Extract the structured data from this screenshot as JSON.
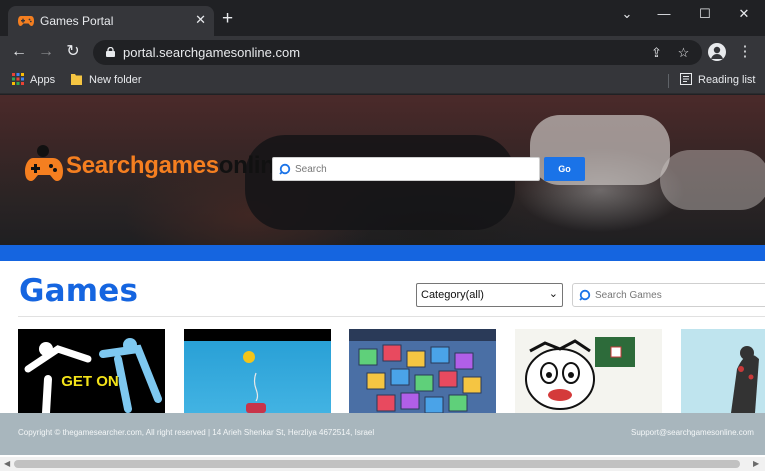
{
  "browser": {
    "tab_title": "Games Portal",
    "url": "portal.searchgamesonline.com",
    "bookmarks": {
      "apps_label": "Apps",
      "folder_label": "New folder",
      "reading_list_label": "Reading list"
    }
  },
  "page": {
    "logo": {
      "part1": "Searchgames",
      "part2": "online"
    },
    "hero_search": {
      "placeholder": "Search",
      "button": "Go"
    },
    "section_title": "Games",
    "category_select": {
      "selected": "Category(all)"
    },
    "games_search": {
      "placeholder": "Search Games"
    },
    "thumbnails": [
      {
        "text": "GET ON"
      },
      {
        "text": ""
      },
      {
        "text": ""
      },
      {
        "text": ""
      },
      {
        "text": ""
      }
    ],
    "footer": {
      "copyright": "Copyright © thegamesearcher.com, All right reserved | 14 Arieh Shenkar St, Herzliya 4672514, Israel",
      "support": "Support@searchgamesonline.com"
    }
  },
  "colors": {
    "accent_blue": "#1565e0",
    "logo_orange": "#f57f20",
    "footer_bg": "#a8b6bd"
  }
}
